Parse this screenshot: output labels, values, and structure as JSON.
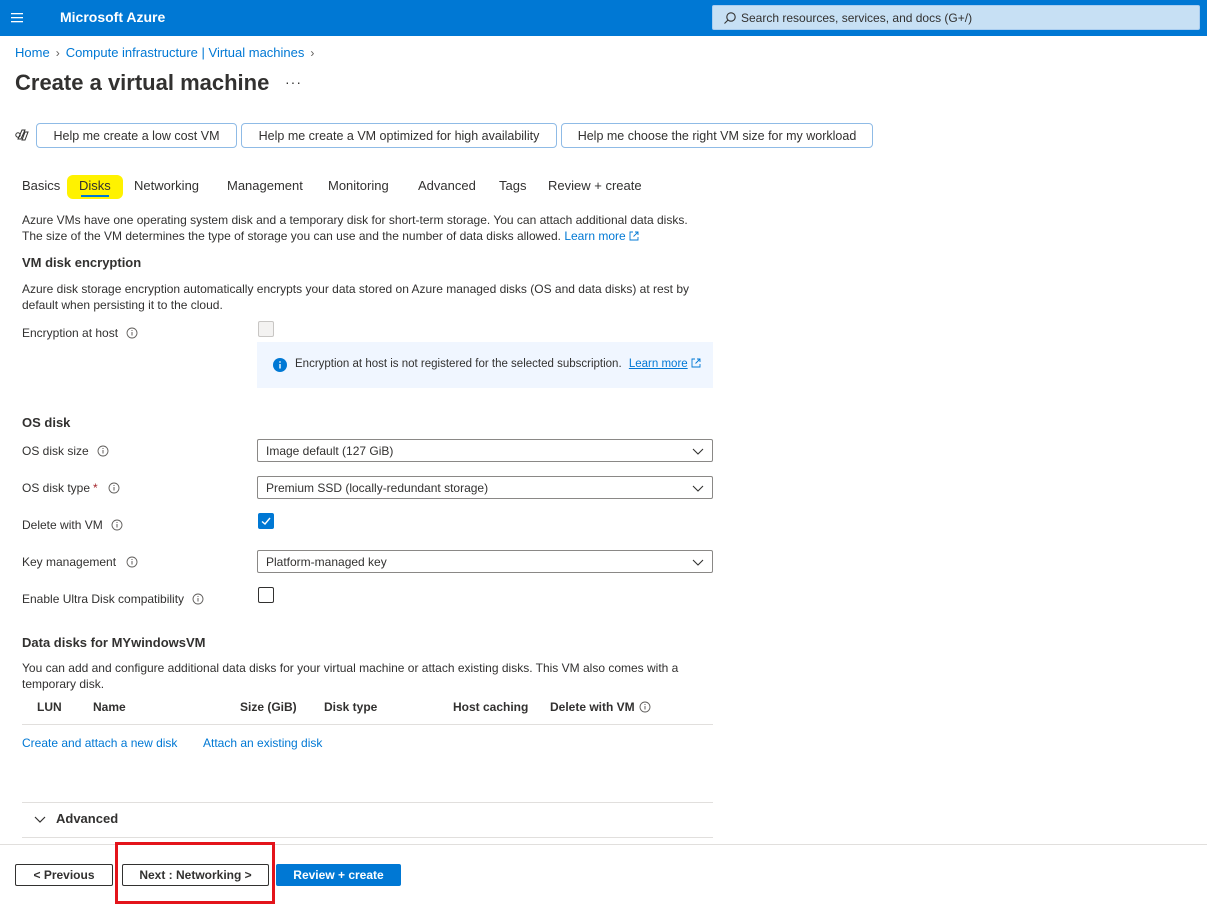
{
  "topbar": {
    "brand": "Microsoft Azure",
    "search_placeholder": "Search resources, services, and docs (G+/)"
  },
  "breadcrumb": [
    "Home",
    "Compute infrastructure | Virtual machines"
  ],
  "page": {
    "title": "Create a virtual machine",
    "more": "···"
  },
  "help_buttons": [
    "Help me create a low cost VM",
    "Help me create a VM optimized for high availability",
    "Help me choose the right VM size for my workload"
  ],
  "tabs": [
    "Basics",
    "Disks",
    "Networking",
    "Management",
    "Monitoring",
    "Advanced",
    "Tags",
    "Review + create"
  ],
  "active_tab": "Disks",
  "intro": {
    "line1": "Azure VMs have one operating system disk and a temporary disk for short-term storage. You can attach additional data disks.",
    "line2": "The size of the VM determines the type of storage you can use and the number of data disks allowed.",
    "learn_more": "Learn more"
  },
  "encryption": {
    "title": "VM disk encryption",
    "desc1": "Azure disk storage encryption automatically encrypts your data stored on Azure managed disks (OS and data disks) at rest by",
    "desc2": "default when persisting it to the cloud.",
    "host_label": "Encryption at host",
    "info_text": "Encryption at host is not registered for the selected subscription.",
    "info_link": "Learn more"
  },
  "os_disk": {
    "title": "OS disk",
    "size_label": "OS disk size",
    "size_value": "Image default (127 GiB)",
    "type_label": "OS disk type",
    "type_required": "*",
    "type_value": "Premium SSD (locally-redundant storage)",
    "delete_label": "Delete with VM",
    "delete_checked": true,
    "key_label": "Key management",
    "key_value": "Platform-managed key",
    "ultra_label": "Enable Ultra Disk compatibility",
    "ultra_checked": false
  },
  "data_disks": {
    "title": "Data disks for MYwindowsVM",
    "desc1": "You can add and configure additional data disks for your virtual machine or attach existing disks. This VM also comes with a",
    "desc2": "temporary disk.",
    "columns": [
      "LUN",
      "Name",
      "Size (GiB)",
      "Disk type",
      "Host caching",
      "Delete with VM"
    ],
    "create_link": "Create and attach a new disk",
    "attach_link": "Attach an existing disk"
  },
  "advanced": {
    "label": "Advanced"
  },
  "footer": {
    "previous": "< Previous",
    "next": "Next : Networking >",
    "review": "Review + create"
  },
  "colors": {
    "azure_blue": "#0078d4",
    "highlight_yellow": "#fff200",
    "annotation_red": "#e3141b"
  }
}
